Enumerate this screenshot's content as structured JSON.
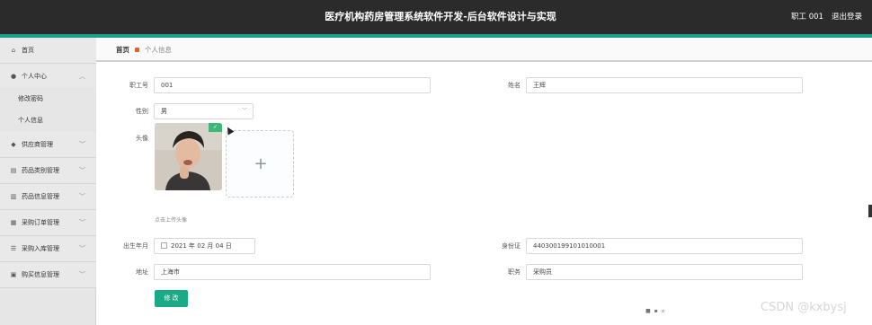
{
  "header": {
    "title": "医疗机构药房管理系统软件开发-后台软件设计与实现",
    "user": "职工 001",
    "logout": "退出登录"
  },
  "sidebar": {
    "items": [
      {
        "label": "首页",
        "icon": "home-icon",
        "expanded": false
      },
      {
        "label": "个人中心",
        "icon": "user-icon",
        "expanded": true
      },
      {
        "label": "供应商管理",
        "icon": "supplier-icon",
        "expanded": false
      },
      {
        "label": "药品类别管理",
        "icon": "category-icon",
        "expanded": false
      },
      {
        "label": "药品信息管理",
        "icon": "chart-icon",
        "expanded": false
      },
      {
        "label": "采购订单管理",
        "icon": "order-icon",
        "expanded": false
      },
      {
        "label": "采购入库管理",
        "icon": "stock-icon",
        "expanded": false
      },
      {
        "label": "购买信息管理",
        "icon": "purchase-icon",
        "expanded": false
      }
    ],
    "sub_items": [
      {
        "label": "修改密码"
      },
      {
        "label": "个人信息"
      }
    ]
  },
  "breadcrumb": {
    "home": "首页",
    "current": "个人信息"
  },
  "form": {
    "employee_id": {
      "label": "职工号",
      "value": "001"
    },
    "name": {
      "label": "姓名",
      "value": "王辉"
    },
    "gender": {
      "label": "性别",
      "value": "男"
    },
    "avatar": {
      "label": "头像",
      "hint": "点击上传头像"
    },
    "birthdate": {
      "label": "出生年月",
      "value": "2021 年 02 月 04 日"
    },
    "id_card": {
      "label": "身份证",
      "value": "440300199101010001"
    },
    "address": {
      "label": "地址",
      "value": "上海市"
    },
    "position": {
      "label": "职务",
      "value": "采购员"
    },
    "submit": "修 改"
  },
  "watermark": "CSDN @kxbysj",
  "colors": {
    "topbar": "#2b2b2b",
    "accent": "#1a9e8e",
    "button": "#1aaa88",
    "breadcrumb_dot": "#e06030"
  }
}
